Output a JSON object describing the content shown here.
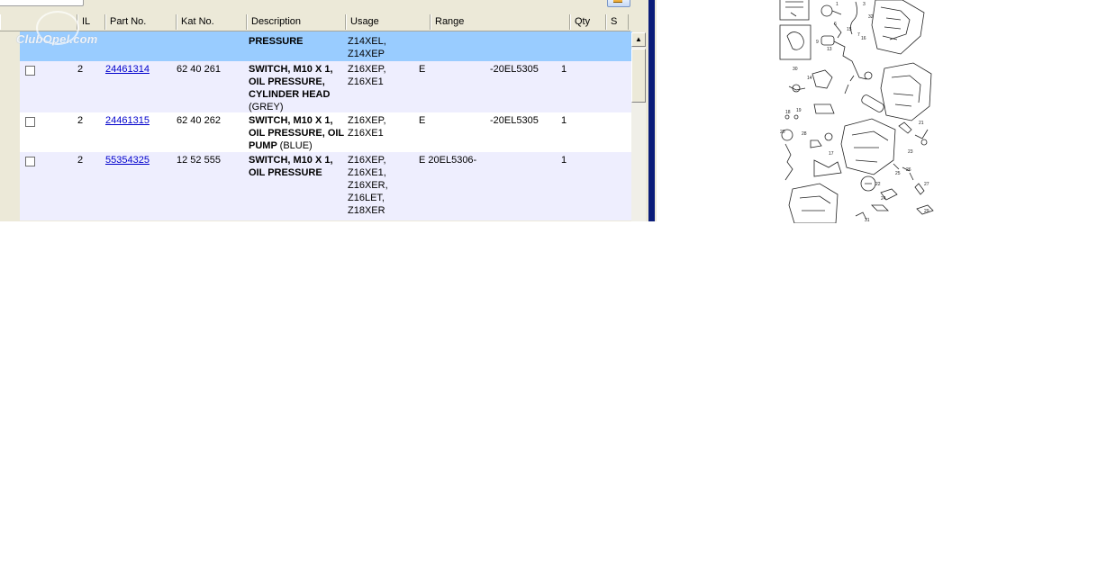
{
  "watermark": "ClubOpel.com",
  "columns": {
    "il": "IL",
    "part_no": "Part No.",
    "kat_no": "Kat No.",
    "description": "Description",
    "usage": "Usage",
    "range": "Range",
    "qty": "Qty",
    "s": "S"
  },
  "rows": [
    {
      "desc": "PRESSURE",
      "usage": "Z14XEL,\nZ14XEP"
    },
    {
      "il": "2",
      "part_no": "24461314",
      "kat_no": "62 40 261",
      "desc": "SWITCH, M10 X 1,\nOIL PRESSURE,\nCYLINDER HEAD",
      "note": "(GREY)",
      "usage": "Z16XEP,\nZ16XE1",
      "range_code": "E",
      "range": "-20EL5305",
      "qty": "1"
    },
    {
      "il": "2",
      "part_no": "24461315",
      "kat_no": "62 40 262",
      "desc": "SWITCH, M10 X 1,\nOIL PRESSURE, OIL\nPUMP",
      "note": "(BLUE)",
      "usage": "Z16XEP,\nZ16XE1",
      "range_code": "E",
      "range": "-20EL5305",
      "qty": "1"
    },
    {
      "il": "2",
      "part_no": "55354325",
      "kat_no": "12 52 555",
      "desc": "SWITCH, M10 X 1,\nOIL PRESSURE",
      "usage": "Z16XEP,\nZ16XE1,\nZ16XER,\nZ16LET,\nZ18XER",
      "range_code": "E 20EL5306-",
      "qty": "1"
    }
  ],
  "diagram_callouts": [
    "1",
    "3",
    "6",
    "7",
    "9",
    "13",
    "14",
    "15",
    "16",
    "17",
    "18",
    "19",
    "20",
    "21",
    "22",
    "23",
    "24",
    "25",
    "26",
    "27",
    "28",
    "29",
    "30",
    "31",
    "32"
  ]
}
